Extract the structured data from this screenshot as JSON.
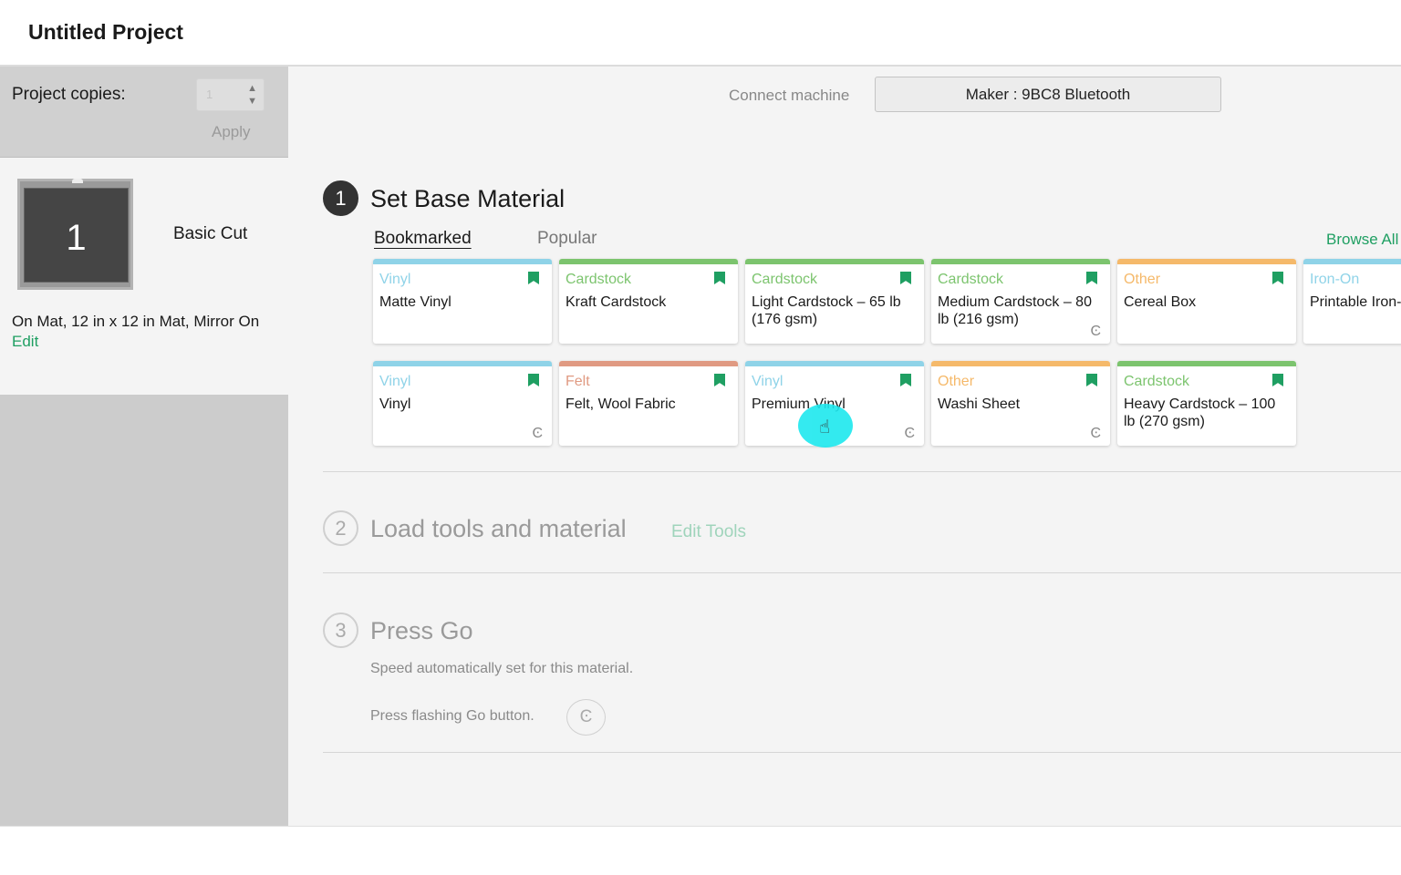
{
  "header": {
    "title": "Untitled Project"
  },
  "sidebar": {
    "copies_label": "Project copies:",
    "copies_value": "1",
    "stepper_arrows": "▲\n▼",
    "apply_label": "Apply",
    "mat_number": "1",
    "cut_name": "Basic Cut",
    "mat_info": "On Mat, 12 in x 12 in Mat, Mirror On",
    "edit_label": "Edit"
  },
  "connect": {
    "label": "Connect machine",
    "machine": "Maker : 9BC8 Bluetooth"
  },
  "step1": {
    "number": "1",
    "title": "Set Base Material",
    "tabs": [
      "Bookmarked",
      "Popular"
    ],
    "browse_label": "Browse All",
    "cards": [
      {
        "category": "Vinyl",
        "name": "Matte Vinyl",
        "color": "#8fd3e8",
        "cut_icon": false
      },
      {
        "category": "Cardstock",
        "name": "Kraft Cardstock",
        "color": "#7cc46e",
        "cut_icon": false
      },
      {
        "category": "Cardstock",
        "name": "Light Cardstock – 65 lb (176 gsm)",
        "color": "#7cc46e",
        "cut_icon": false
      },
      {
        "category": "Cardstock",
        "name": "Medium Cardstock – 80 lb (216 gsm)",
        "color": "#7cc46e",
        "cut_icon": true
      },
      {
        "category": "Other",
        "name": "Cereal Box",
        "color": "#f5b96a",
        "cut_icon": false
      },
      {
        "category": "Iron-On",
        "name": "Printable Iron-On Light",
        "color": "#8fd3e8",
        "cut_icon": false
      },
      {
        "category": "Vinyl",
        "name": "Vinyl",
        "color": "#8fd3e8",
        "cut_icon": true
      },
      {
        "category": "Felt",
        "name": "Felt, Wool Fabric",
        "color": "#e09a82",
        "cut_icon": false
      },
      {
        "category": "Vinyl",
        "name": "Premium Vinyl",
        "color": "#8fd3e8",
        "cut_icon": true
      },
      {
        "category": "Other",
        "name": "Washi Sheet",
        "color": "#f5b96a",
        "cut_icon": true
      },
      {
        "category": "Cardstock",
        "name": "Heavy Cardstock – 100 lb (270 gsm)",
        "color": "#7cc46e",
        "cut_icon": false
      }
    ]
  },
  "step2": {
    "number": "2",
    "title": "Load tools and material",
    "edit_tools": "Edit Tools"
  },
  "step3": {
    "number": "3",
    "title": "Press Go",
    "speed_note": "Speed automatically set for this material.",
    "press_note": "Press flashing Go button.",
    "go_glyph": "Ͼ"
  },
  "icons": {
    "cut": "Ͼ",
    "hand": "☝"
  },
  "colors": {
    "accent": "#1f9f62",
    "vinyl": "#8fd3e8",
    "cardstock": "#7cc46e",
    "other": "#f5b96a",
    "felt": "#e09a82"
  }
}
